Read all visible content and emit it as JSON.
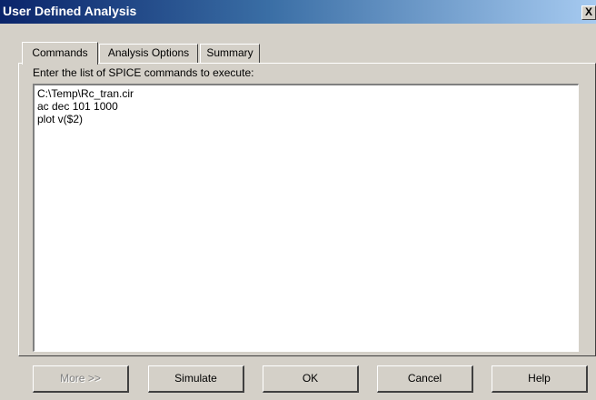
{
  "window": {
    "title": "User Defined Analysis",
    "close_glyph": "X"
  },
  "tabs": [
    {
      "label": "Commands",
      "active": true
    },
    {
      "label": "Analysis Options",
      "active": false
    },
    {
      "label": "Summary",
      "active": false
    }
  ],
  "commands_tab": {
    "instruction": "Enter the list of SPICE commands to execute:",
    "lines": [
      "C:\\Temp\\Rc_tran.cir",
      "ac dec 101 1000",
      "plot v($2)"
    ]
  },
  "buttons": {
    "more": "More >>",
    "simulate": "Simulate",
    "ok": "OK",
    "cancel": "Cancel",
    "help": "Help"
  }
}
